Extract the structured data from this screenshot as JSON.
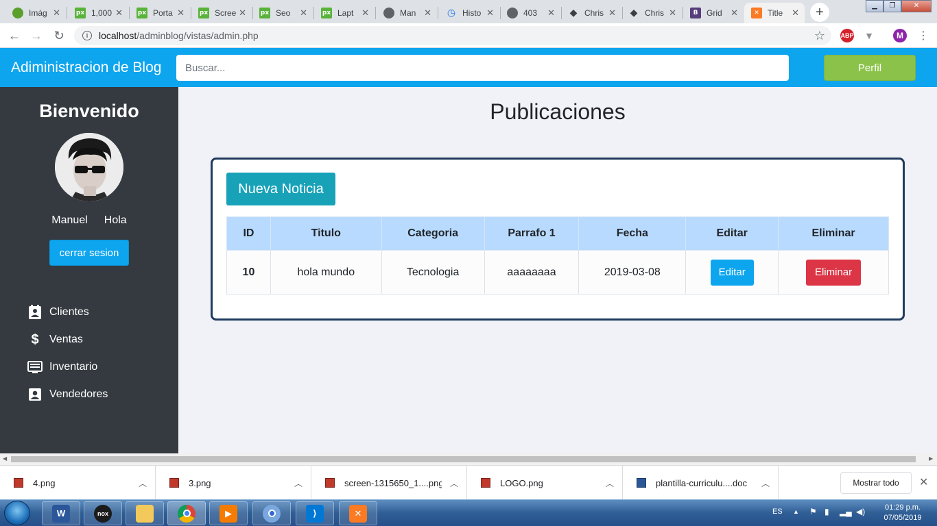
{
  "browser": {
    "tabs": [
      {
        "title": "Imág",
        "favicon": "globe-green-icon",
        "color": "#5aa02c"
      },
      {
        "title": "1,000",
        "favicon": "px-icon",
        "color": "#59b33a"
      },
      {
        "title": "Porta",
        "favicon": "px-icon",
        "color": "#59b33a"
      },
      {
        "title": "Scree",
        "favicon": "px-icon",
        "color": "#59b33a"
      },
      {
        "title": "Seo",
        "favicon": "px-icon",
        "color": "#59b33a"
      },
      {
        "title": "Lapt",
        "favicon": "px-icon",
        "color": "#59b33a"
      },
      {
        "title": "Man",
        "favicon": "globe-icon",
        "color": "#5f6368"
      },
      {
        "title": "Histo",
        "favicon": "history-icon",
        "color": "#1a73e8"
      },
      {
        "title": "403",
        "favicon": "globe-icon",
        "color": "#5f6368"
      },
      {
        "title": "Chris",
        "favicon": "diamond-icon",
        "color": "#3c4043"
      },
      {
        "title": "Chris",
        "favicon": "diamond-icon",
        "color": "#3c4043"
      },
      {
        "title": "Grid",
        "favicon": "bootstrap-icon",
        "color": "#563d7c"
      },
      {
        "title": "Title",
        "favicon": "xampp-icon",
        "color": "#fb7a24"
      }
    ],
    "url_host": "localhost",
    "url_path": "/adminblog/vistas/admin.php",
    "profile_initial": "M",
    "abp_label": "ABP"
  },
  "header": {
    "brand": "Adiministracion de Blog",
    "search_placeholder": "Buscar...",
    "profile_button": "Perfil"
  },
  "sidebar": {
    "welcome": "Bienvenido",
    "user_first": "Manuel",
    "user_second": "Hola",
    "logout": "cerrar sesion",
    "items": [
      {
        "label": "Clientes",
        "icon": "contact-card-icon"
      },
      {
        "label": "Ventas",
        "icon": "dollar-icon"
      },
      {
        "label": "Inventario",
        "icon": "list-icon"
      },
      {
        "label": "Vendedores",
        "icon": "person-box-icon"
      }
    ]
  },
  "main": {
    "title": "Publicaciones",
    "new_button": "Nueva Noticia",
    "table": {
      "headers": [
        "ID",
        "Titulo",
        "Categoria",
        "Parrafo 1",
        "Fecha",
        "Editar",
        "Eliminar"
      ],
      "rows": [
        {
          "id": "10",
          "titulo": "hola mundo",
          "categoria": "Tecnologia",
          "parrafo": "aaaaaaaa",
          "fecha": "2019-03-08",
          "edit": "Editar",
          "delete": "Eliminar"
        }
      ]
    }
  },
  "downloads": {
    "items": [
      {
        "name": "4.png",
        "type": "image"
      },
      {
        "name": "3.png",
        "type": "image"
      },
      {
        "name": "screen-1315650_1....png",
        "type": "image"
      },
      {
        "name": "LOGO.png",
        "type": "image"
      },
      {
        "name": "plantilla-curriculu....doc",
        "type": "doc"
      }
    ],
    "show_all": "Mostrar todo"
  },
  "taskbar": {
    "apps": [
      "word-icon",
      "nox-icon",
      "explorer-icon",
      "chrome-icon",
      "media-player-icon",
      "chrome-canary-icon",
      "vscode-icon",
      "xampp-icon"
    ],
    "language": "ES",
    "time": "01:29 p.m.",
    "date": "07/05/2019"
  }
}
